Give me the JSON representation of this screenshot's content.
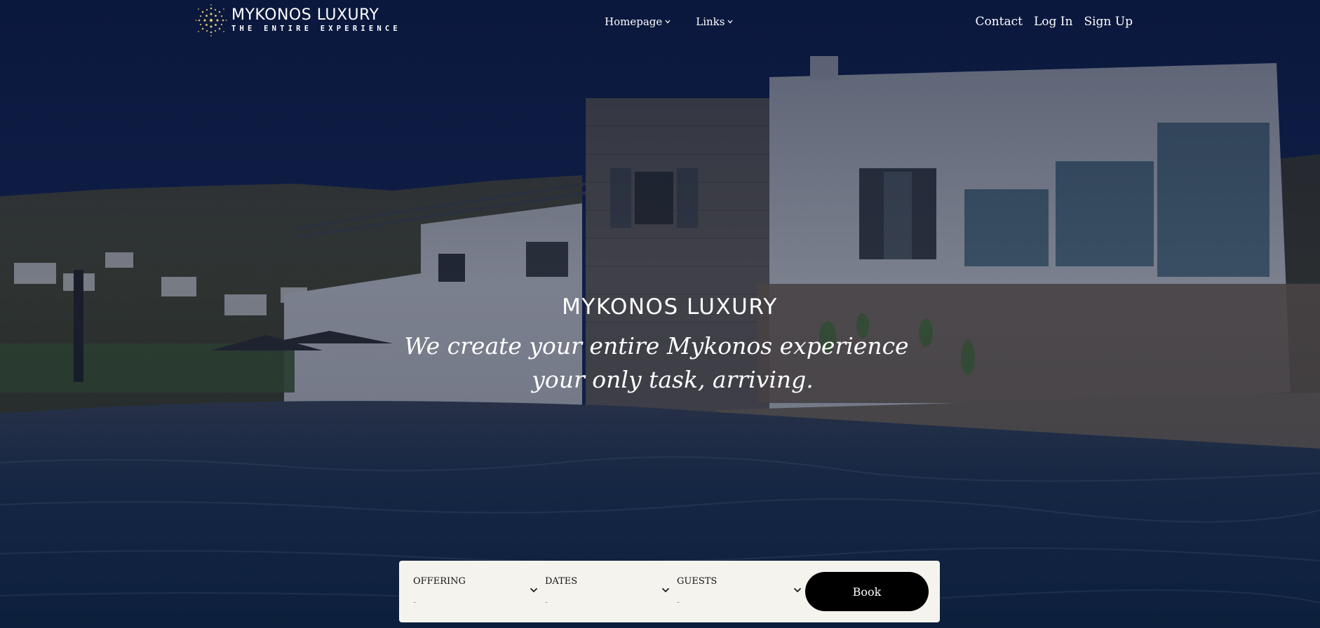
{
  "brand": {
    "name": "MYKONOS LUXURY",
    "tagline": "THE ENTIRE EXPERIENCE"
  },
  "nav": {
    "center": [
      {
        "label": "Homepage",
        "icon": "chevron-down-icon"
      },
      {
        "label": "Links",
        "icon": "chevron-down-icon"
      }
    ],
    "right": [
      {
        "label": "Contact"
      },
      {
        "label": "Log In"
      },
      {
        "label": "Sign Up"
      }
    ]
  },
  "hero": {
    "title": "MYKONOS LUXURY",
    "line1": "We create your entire Mykonos experience",
    "line2": "your only task, arriving."
  },
  "booking": {
    "fields": [
      {
        "label": "OFFERING",
        "value": "-",
        "icon": "chevron-down-icon"
      },
      {
        "label": "DATES",
        "value": "-",
        "icon": "chevron-down-icon"
      },
      {
        "label": "GUESTS",
        "value": "-",
        "icon": "chevron-down-icon"
      }
    ],
    "button_label": "Book"
  },
  "colors": {
    "overlay": "#0d1a3d",
    "booking_bg": "#f5f3ee",
    "button_bg": "#000000",
    "logo_accent": "#d8c26a"
  }
}
